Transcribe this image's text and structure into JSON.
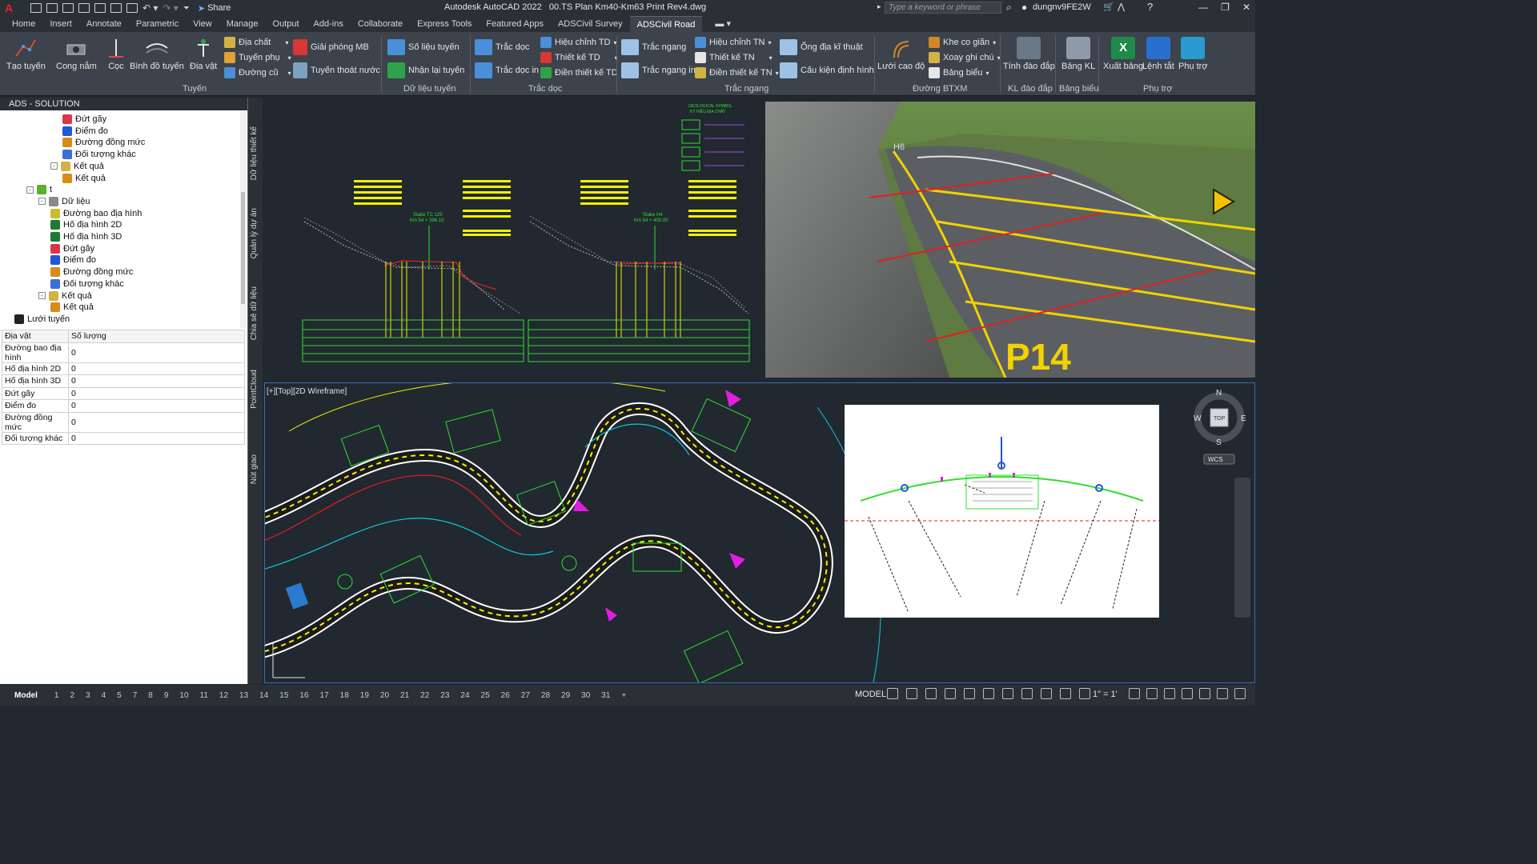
{
  "titlebar": {
    "logo": "A",
    "share_label": "Share",
    "app_title": "Autodesk AutoCAD 2022",
    "file_name": "00.TS Plan Km40-Km63 Print Rev4.dwg",
    "search_placeholder": "Type a keyword or phrase",
    "user_name": "dungnv9FE2W"
  },
  "ribbon_tabs": [
    "Home",
    "Insert",
    "Annotate",
    "Parametric",
    "View",
    "Manage",
    "Output",
    "Add-ins",
    "Collaborate",
    "Express Tools",
    "Featured Apps",
    "ADSCivil Survey",
    "ADSCivil Road"
  ],
  "active_tab_index": 12,
  "ribbon": {
    "tao_tuyen": "Tạo tuyến",
    "cong_nam": "Cong nắm",
    "coc": "Cọc",
    "binh_do_tuyen": "Bình đồ tuyến",
    "dia_vat": "Địa vật",
    "dia_chat": "Địa chất",
    "tuyen_phu": "Tuyến phụ",
    "duong_cu": "Đường cũ",
    "giai_phong_mb": "Giải phóng MB",
    "tuyen_thoat_nuoc": "Tuyến thoát nước",
    "group_tuyen": "Tuyến",
    "so_lieu_tuyen": "Số liệu tuyến",
    "nhan_lai_tuyen": "Nhận lại tuyến",
    "group_du_lieu_tuyen": "Dữ liệu tuyến",
    "trac_doc": "Trắc dọc",
    "trac_doc_in": "Trắc dọc in",
    "hieu_chinh_td": "Hiệu chỉnh TD",
    "thiet_ke_td": "Thiết kế TD",
    "dien_thiet_ke_td": "Điền thiết kế TD",
    "group_trac_doc": "Trắc dọc",
    "trac_ngang": "Trắc ngang",
    "trac_ngang_in": "Trắc ngang in",
    "hieu_chinh_tn": "Hiệu chỉnh TN",
    "thiet_ke_tn": "Thiết kế TN",
    "dien_thiet_ke_tn": "Điền thiết kế TN",
    "ong_dia_ki_thuat": "Ống địa kĩ thuật",
    "cau_kien_dinh_hinh": "Cấu kiện định hình",
    "group_trac_ngang": "Trắc ngang",
    "luoi_cao_do": "Lưới cao độ",
    "khe_co_gian": "Khe co giãn",
    "xoay_ghi_chu": "Xoay ghi chú",
    "bang_bieu": "Bảng biểu",
    "group_duong_btxm": "Đường BTXM",
    "tinh_dao_dap": "Tính đào đắp",
    "group_kl_dao_dap": "KL đào đắp",
    "bang_kl": "Bảng KL",
    "group_bang_bieu": "Bảng biểu",
    "xuat_bang": "Xuất bảng",
    "lenh_tat": "Lệnh tắt",
    "phu_tro": "Phụ trợ",
    "group_phu_tro": "Phụ trợ"
  },
  "palette": {
    "title": "ADS - SOLUTION",
    "tree": [
      {
        "label": "Đứt gãy",
        "indent": 4,
        "icon": "fault-icon",
        "color": "#d9364b"
      },
      {
        "label": "Điểm đo",
        "indent": 4,
        "icon": "point-icon",
        "color": "#1f57d6"
      },
      {
        "label": "Đường đồng mức",
        "indent": 4,
        "icon": "contour-icon",
        "color": "#d98b1a"
      },
      {
        "label": "Đối tượng khác",
        "indent": 4,
        "icon": "object-icon",
        "color": "#3b6fd6"
      },
      {
        "label": "Kết quả",
        "indent": 3,
        "icon": "folder-icon",
        "color": "#d2b245",
        "expander": "-"
      },
      {
        "label": "Kết quả",
        "indent": 4,
        "icon": "result-icon",
        "color": "#d98b1a"
      },
      {
        "label": "t",
        "indent": 1,
        "icon": "project-icon",
        "color": "#5cb030",
        "expander": "-"
      },
      {
        "label": "Dữ liệu",
        "indent": 2,
        "icon": "data-icon",
        "color": "#8a8a8a",
        "expander": "-"
      },
      {
        "label": "Đường bao địa hình",
        "indent": 3,
        "icon": "boundary-icon",
        "color": "#c6c02a"
      },
      {
        "label": "Hố địa hình 2D",
        "indent": 3,
        "icon": "terrain-2d-icon",
        "color": "#1d7a2f"
      },
      {
        "label": "Hố địa hình 3D",
        "indent": 3,
        "icon": "terrain-3d-icon",
        "color": "#1d7a2f"
      },
      {
        "label": "Đứt gãy",
        "indent": 3,
        "icon": "fault-icon",
        "color": "#d9364b"
      },
      {
        "label": "Điểm đo",
        "indent": 3,
        "icon": "point-icon",
        "color": "#1f57d6"
      },
      {
        "label": "Đường đồng mức",
        "indent": 3,
        "icon": "contour-icon",
        "color": "#d98b1a"
      },
      {
        "label": "Đối tượng khác",
        "indent": 3,
        "icon": "object-icon",
        "color": "#3b6fd6"
      },
      {
        "label": "Kết quả",
        "indent": 2,
        "icon": "folder-icon",
        "color": "#d2b245",
        "expander": "-"
      },
      {
        "label": "Kết quả",
        "indent": 3,
        "icon": "result-icon",
        "color": "#d98b1a"
      },
      {
        "label": "Lưới tuyến",
        "indent": 0,
        "icon": "grid-line-icon",
        "color": "#222222"
      }
    ],
    "table_headers": [
      "Địa vật",
      "Số lượng"
    ],
    "table_rows": [
      [
        "Đường bao địa hình",
        "0"
      ],
      [
        "Hố địa hình 2D",
        "0"
      ],
      [
        "Hố địa hình 3D",
        "0"
      ],
      [
        "Đứt gãy",
        "0"
      ],
      [
        "Điểm đo",
        "0"
      ],
      [
        "Đường đồng mức",
        "0"
      ],
      [
        "Đối tượng khác",
        "0"
      ]
    ],
    "side_tabs": [
      "Dữ liệu thiết kế",
      "Quản lý dự án",
      "Chia sẻ dữ liệu",
      "PointCloud",
      "Nút giao"
    ]
  },
  "viewports": {
    "bottom_label": "[+][Top][2D Wireframe]",
    "section_left_stake": "Stake TC 125",
    "section_left_km": "Km 54 + 396.10",
    "section_right_stake": "Stake H4",
    "section_right_km": "Km 54 + 400.00",
    "geo_title": "GEOLOGICAL SYMBOL",
    "geo_subtitle": "KÝ HIỆU ĐỊA CHẤT",
    "road_marking": "P14",
    "sign_label": "H6"
  },
  "navcube": {
    "n": "N",
    "s": "S",
    "e": "E",
    "w": "W",
    "top": "TOP",
    "wcs": "WCS"
  },
  "statusbar": {
    "model_tab": "Model",
    "layouts": [
      "1",
      "2",
      "3",
      "4",
      "5",
      "7",
      "8",
      "9",
      "10",
      "11",
      "12",
      "13",
      "14",
      "15",
      "16",
      "17",
      "18",
      "19",
      "20",
      "21",
      "22",
      "23",
      "24",
      "25",
      "26",
      "27",
      "28",
      "29",
      "30",
      "31",
      "+"
    ],
    "model_label": "MODEL",
    "scale": "1\" = 1'"
  },
  "colors": {
    "accent_blue": "#3a6fb0",
    "cad_green": "#2ee02e",
    "cad_yellow": "#f2f200",
    "cad_magenta": "#e01ee0",
    "cad_red": "#e02020",
    "cad_cyan": "#10c8d8"
  }
}
